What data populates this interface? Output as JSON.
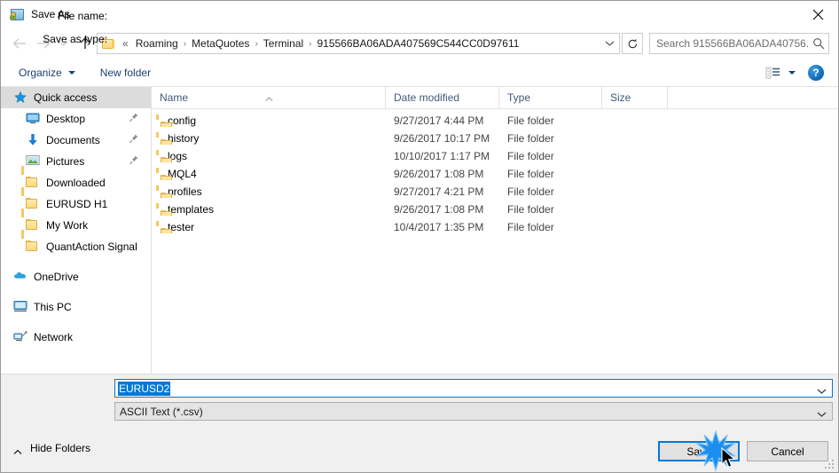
{
  "titlebar": {
    "title": "Save As",
    "icon": "save-as-icon",
    "close_label": "✕"
  },
  "nav": {
    "back": "back-arrow",
    "forward": "forward-arrow",
    "recent": "recent-locations-chevron",
    "up": "up-arrow",
    "address": {
      "leading_ellipsis": "«",
      "crumbs": [
        "Roaming",
        "MetaQuotes",
        "Terminal",
        "915566BA06ADA407569C544CC0D97611"
      ],
      "separator": "›",
      "dropdown": "chevron-down-icon",
      "refresh": "refresh-icon"
    },
    "search": {
      "placeholder": "Search 915566BA06ADA40756...",
      "icon": "search-icon"
    }
  },
  "toolbar": {
    "organize": "Organize",
    "new_folder": "New folder",
    "view_icon": "view-layout-icon",
    "view_caret": "chevron-down-icon",
    "help": "?"
  },
  "sidebar": {
    "items": [
      {
        "label": "Quick access",
        "icon": "star-icon",
        "selected": true,
        "indent": false,
        "pinned": false
      },
      {
        "label": "Desktop",
        "icon": "desktop-icon",
        "selected": false,
        "indent": true,
        "pinned": true
      },
      {
        "label": "Documents",
        "icon": "documents-download-icon",
        "selected": false,
        "indent": true,
        "pinned": true
      },
      {
        "label": "Pictures",
        "icon": "pictures-icon",
        "selected": false,
        "indent": true,
        "pinned": true
      },
      {
        "label": "Downloaded",
        "icon": "folder-icon",
        "selected": false,
        "indent": true,
        "pinned": false
      },
      {
        "label": "EURUSD H1",
        "icon": "folder-icon",
        "selected": false,
        "indent": true,
        "pinned": false
      },
      {
        "label": "My Work",
        "icon": "folder-icon",
        "selected": false,
        "indent": true,
        "pinned": false
      },
      {
        "label": "QuantAction Signal",
        "icon": "folder-icon",
        "selected": false,
        "indent": true,
        "pinned": false
      },
      {
        "label": "OneDrive",
        "icon": "onedrive-cloud-icon",
        "selected": false,
        "indent": false,
        "pinned": false,
        "gap_before": true
      },
      {
        "label": "This PC",
        "icon": "this-pc-icon",
        "selected": false,
        "indent": false,
        "pinned": false,
        "gap_before": true
      },
      {
        "label": "Network",
        "icon": "network-icon",
        "selected": false,
        "indent": false,
        "pinned": false,
        "gap_before": true
      }
    ]
  },
  "filelist": {
    "columns": [
      "Name",
      "Date modified",
      "Type",
      "Size"
    ],
    "sort_column": "Name",
    "sort_direction": "ascending",
    "rows": [
      {
        "name": "config",
        "date": "9/27/2017 4:44 PM",
        "type": "File folder",
        "size": ""
      },
      {
        "name": "history",
        "date": "9/26/2017 10:17 PM",
        "type": "File folder",
        "size": ""
      },
      {
        "name": "logs",
        "date": "10/10/2017 1:17 PM",
        "type": "File folder",
        "size": ""
      },
      {
        "name": "MQL4",
        "date": "9/26/2017 1:08 PM",
        "type": "File folder",
        "size": ""
      },
      {
        "name": "profiles",
        "date": "9/27/2017 4:21 PM",
        "type": "File folder",
        "size": ""
      },
      {
        "name": "templates",
        "date": "9/26/2017 1:08 PM",
        "type": "File folder",
        "size": ""
      },
      {
        "name": "tester",
        "date": "10/4/2017 1:35 PM",
        "type": "File folder",
        "size": ""
      }
    ]
  },
  "form": {
    "filename_label": "File name:",
    "filename_value": "EURUSD2",
    "savetype_label": "Save as type:",
    "savetype_value": "ASCII Text (*.csv)",
    "dropdown_icon": "chevron-down-icon"
  },
  "footer": {
    "hide_folders": "Hide Folders",
    "hide_folders_icon": "chevron-up-icon",
    "save": "Save",
    "cancel": "Cancel",
    "resize_grip": "resize-grip"
  },
  "colors": {
    "accent": "#0078d7",
    "selection": "#0078d7",
    "sidebar_selected": "#dcdcdc",
    "header_text": "#41597a",
    "chrome": "#f0f0f0",
    "folder_yellow": "#fcd97a"
  }
}
